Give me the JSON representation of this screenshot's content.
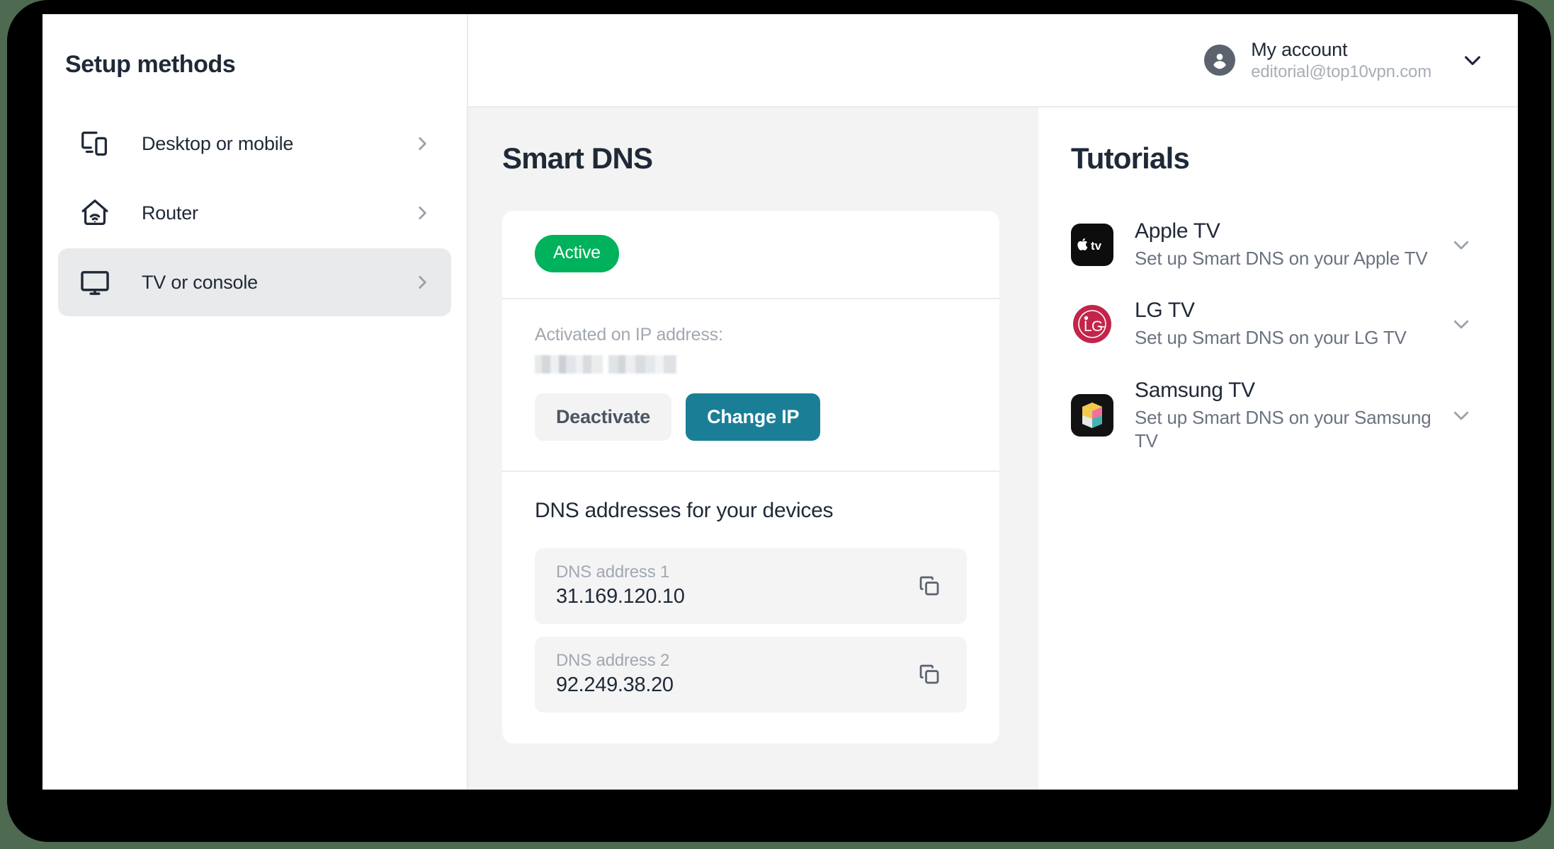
{
  "sidebar": {
    "title": "Setup methods",
    "items": [
      {
        "label": "Desktop or mobile",
        "icon": "devices-icon",
        "selected": false
      },
      {
        "label": "Router",
        "icon": "router-home-icon",
        "selected": false
      },
      {
        "label": "TV or console",
        "icon": "tv-monitor-icon",
        "selected": true
      }
    ]
  },
  "header": {
    "account_name": "My account",
    "account_email": "editorial@top10vpn.com",
    "avatar_icon": "user-avatar-icon",
    "chevron_icon": "chevron-down-icon"
  },
  "main": {
    "title": "Smart DNS",
    "status_badge": "Active",
    "activated_label": "Activated on IP address:",
    "activated_ip": "",
    "deactivate_label": "Deactivate",
    "change_ip_label": "Change IP",
    "dns_heading": "DNS addresses for your devices",
    "dns_rows": [
      {
        "label": "DNS address 1",
        "value": "31.169.120.10",
        "copy_icon": "copy-icon"
      },
      {
        "label": "DNS address 2",
        "value": "92.249.38.20",
        "copy_icon": "copy-icon"
      }
    ]
  },
  "tutorials": {
    "title": "Tutorials",
    "items": [
      {
        "name": "Apple TV",
        "desc": "Set up Smart DNS on your Apple TV",
        "logo": "apple-tv-logo",
        "chevron_icon": "chevron-down-icon"
      },
      {
        "name": "LG TV",
        "desc": "Set up Smart DNS on your LG TV",
        "logo": "lg-logo",
        "chevron_icon": "chevron-down-icon"
      },
      {
        "name": "Samsung TV",
        "desc": "Set up Smart DNS on your Samsung TV",
        "logo": "samsung-logo",
        "chevron_icon": "chevron-down-icon"
      }
    ]
  },
  "colors": {
    "accent_teal": "#1a7f96",
    "status_green": "#00b25c",
    "text_dark": "#1f2937",
    "text_muted": "#a2a8b0",
    "panel_gray": "#f3f3f3",
    "page_background": "#4e6b52"
  }
}
